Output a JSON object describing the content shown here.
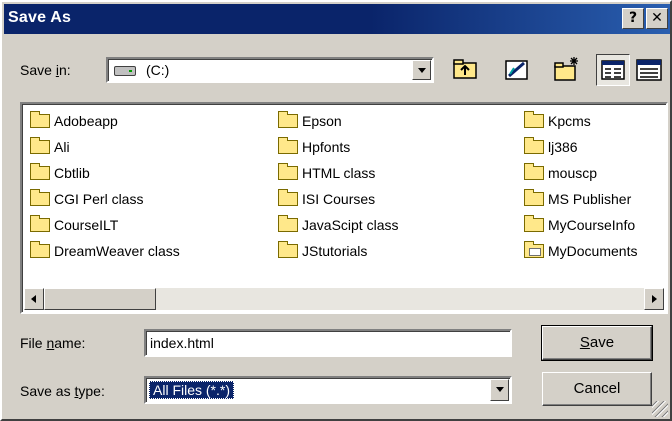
{
  "window": {
    "title": "Save As",
    "help_glyph": "?",
    "close_glyph": "✕"
  },
  "toolbar": {
    "save_in_label_pre": "Save ",
    "save_in_label_ul": "i",
    "save_in_label_post": "n:",
    "save_in_value": "(C:)"
  },
  "files": {
    "col1": [
      "Adobeapp",
      "Ali",
      "Cbtlib",
      "CGI Perl class",
      "CourseILT",
      "DreamWeaver class"
    ],
    "col2": [
      "Epson",
      "Hpfonts",
      "HTML class",
      "ISI Courses",
      "JavaScipt class",
      "JStutorials"
    ],
    "col3": [
      "Kpcms",
      "lj386",
      "mouscp",
      "MS Publisher",
      "MyCourseInfo",
      "MyDocuments"
    ]
  },
  "form": {
    "file_name_label_pre": "File ",
    "file_name_label_ul": "n",
    "file_name_label_post": "ame:",
    "file_name_value": "index.html",
    "save_type_label_pre": "Save as ",
    "save_type_label_ul": "t",
    "save_type_label_post": "ype:",
    "save_type_value": "All Files (*.*)"
  },
  "buttons": {
    "save_ul": "S",
    "save_rest": "ave",
    "cancel": "Cancel"
  },
  "colors": {
    "title_bar": "#0a246a",
    "face": "#d4d0c8",
    "folder": "#ffe88a",
    "selection": "#0a246a"
  }
}
